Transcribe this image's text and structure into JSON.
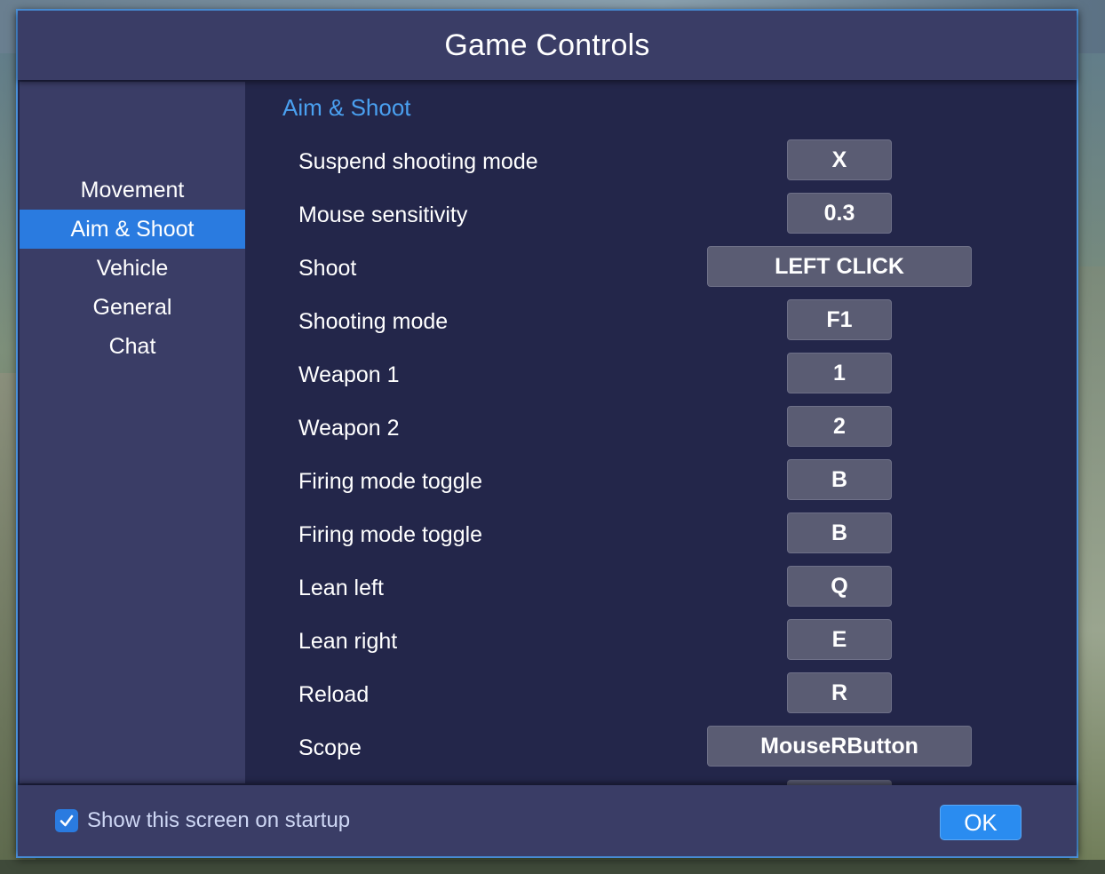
{
  "window": {
    "title": "Game Controls"
  },
  "sidebar": {
    "items": [
      {
        "label": "Movement",
        "active": false
      },
      {
        "label": "Aim & Shoot",
        "active": true
      },
      {
        "label": "Vehicle",
        "active": false
      },
      {
        "label": "General",
        "active": false
      },
      {
        "label": "Chat",
        "active": false
      }
    ]
  },
  "main": {
    "section_title": "Aim & Shoot",
    "controls": [
      {
        "label": "Suspend shooting mode",
        "key": "X"
      },
      {
        "label": "Mouse sensitivity",
        "key": "0.3"
      },
      {
        "label": "Shoot",
        "key": "LEFT CLICK"
      },
      {
        "label": "Shooting mode",
        "key": "F1"
      },
      {
        "label": "Weapon 1",
        "key": "1"
      },
      {
        "label": "Weapon 2",
        "key": "2"
      },
      {
        "label": "Firing mode toggle",
        "key": "B"
      },
      {
        "label": "Firing mode toggle",
        "key": "B"
      },
      {
        "label": "Lean left",
        "key": "Q"
      },
      {
        "label": "Lean right",
        "key": "E"
      },
      {
        "label": "Reload",
        "key": "R"
      },
      {
        "label": "Scope",
        "key": "MouseRButton"
      }
    ]
  },
  "footer": {
    "startup_checkbox_label": "Show this screen on startup",
    "startup_checked": true,
    "ok_label": "OK"
  },
  "colors": {
    "accent": "#2a7be0",
    "section_title": "#4aa0f0",
    "panel": "#3a3d66",
    "content_bg": "#23264a",
    "key_bg": "#5a5c73"
  },
  "icons": {
    "checkbox": "checkmark-icon"
  }
}
